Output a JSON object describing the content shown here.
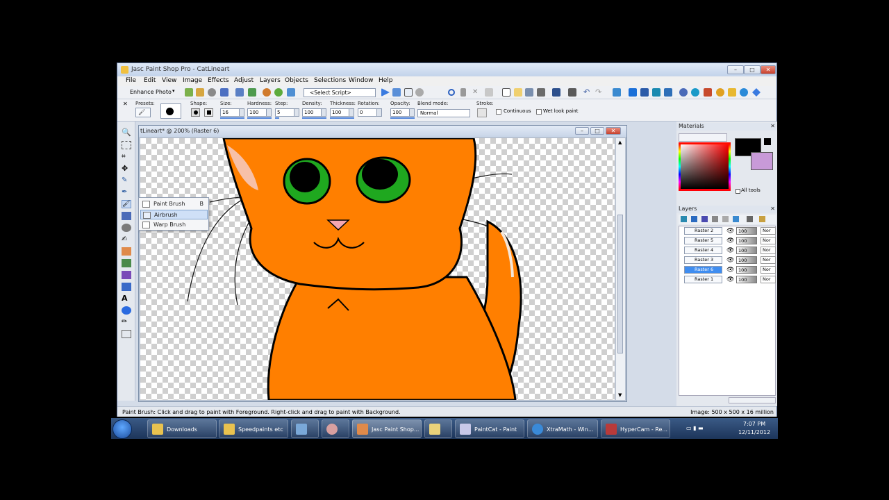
{
  "window": {
    "title": "Jasc Paint Shop Pro - CatLineart",
    "controls": [
      "–",
      "□",
      "✕"
    ]
  },
  "menubar": [
    "File",
    "Edit",
    "View",
    "Image",
    "Effects",
    "Adjust",
    "Layers",
    "Objects",
    "Selections",
    "Window",
    "Help"
  ],
  "toolbar": {
    "enhance_photo": "Enhance Photo",
    "script_select": "<Select Script>"
  },
  "tool_options": {
    "presets_label": "Presets:",
    "shape_label": "Shape:",
    "size_label": "Size:",
    "size": "16",
    "hardness_label": "Hardness:",
    "hardness": "100",
    "step_label": "Step:",
    "step": "5",
    "density_label": "Density:",
    "density": "100",
    "thickness_label": "Thickness:",
    "thickness": "100",
    "rotation_label": "Rotation:",
    "rotation": "0",
    "opacity_label": "Opacity:",
    "opacity": "100",
    "blend_label": "Blend mode:",
    "blend": "Normal",
    "stroke_label": "Stroke:",
    "continuous": "Continuous",
    "wet_look": "Wet look paint"
  },
  "document": {
    "title": "tLineart* @ 200% (Raster 6)"
  },
  "brush_flyout": {
    "items": [
      {
        "label": "Paint Brush",
        "shortcut": "B"
      },
      {
        "label": "Airbrush",
        "shortcut": ""
      },
      {
        "label": "Warp Brush",
        "shortcut": ""
      }
    ]
  },
  "materials": {
    "title": "Materials",
    "all_tools": "All tools"
  },
  "layers": {
    "title": "Layers",
    "rows": [
      {
        "name": "Raster 2",
        "opacity": "100",
        "mode": "Nor"
      },
      {
        "name": "Raster 5",
        "opacity": "100",
        "mode": "Nor"
      },
      {
        "name": "Raster 4",
        "opacity": "100",
        "mode": "Nor"
      },
      {
        "name": "Raster 3",
        "opacity": "100",
        "mode": "Nor"
      },
      {
        "name": "Raster 6",
        "opacity": "100",
        "mode": "Nor"
      },
      {
        "name": "Raster 1",
        "opacity": "100",
        "mode": "Nor"
      }
    ]
  },
  "statusbar": {
    "hint": "Paint Brush: Click and drag to paint with Foreground. Right-click and drag to paint with Background.",
    "image_info": "Image:  500 x 500 x 16 million"
  },
  "taskbar": {
    "items": [
      {
        "label": "Downloads"
      },
      {
        "label": "Speedpaints etc"
      },
      {
        "label": ""
      },
      {
        "label": ""
      },
      {
        "label": "Jasc Paint Shop..."
      },
      {
        "label": ""
      },
      {
        "label": "PaintCat - Paint"
      },
      {
        "label": "XtraMath - Win..."
      },
      {
        "label": "HyperCam - Re..."
      }
    ],
    "time": "7:07 PM",
    "date": "12/11/2012"
  },
  "colors": {
    "cat_orange": "#ff7f00",
    "eye_green": "#1fa81f",
    "nose_pink": "#f4a7b0",
    "layer_active": "#3f8df0"
  }
}
